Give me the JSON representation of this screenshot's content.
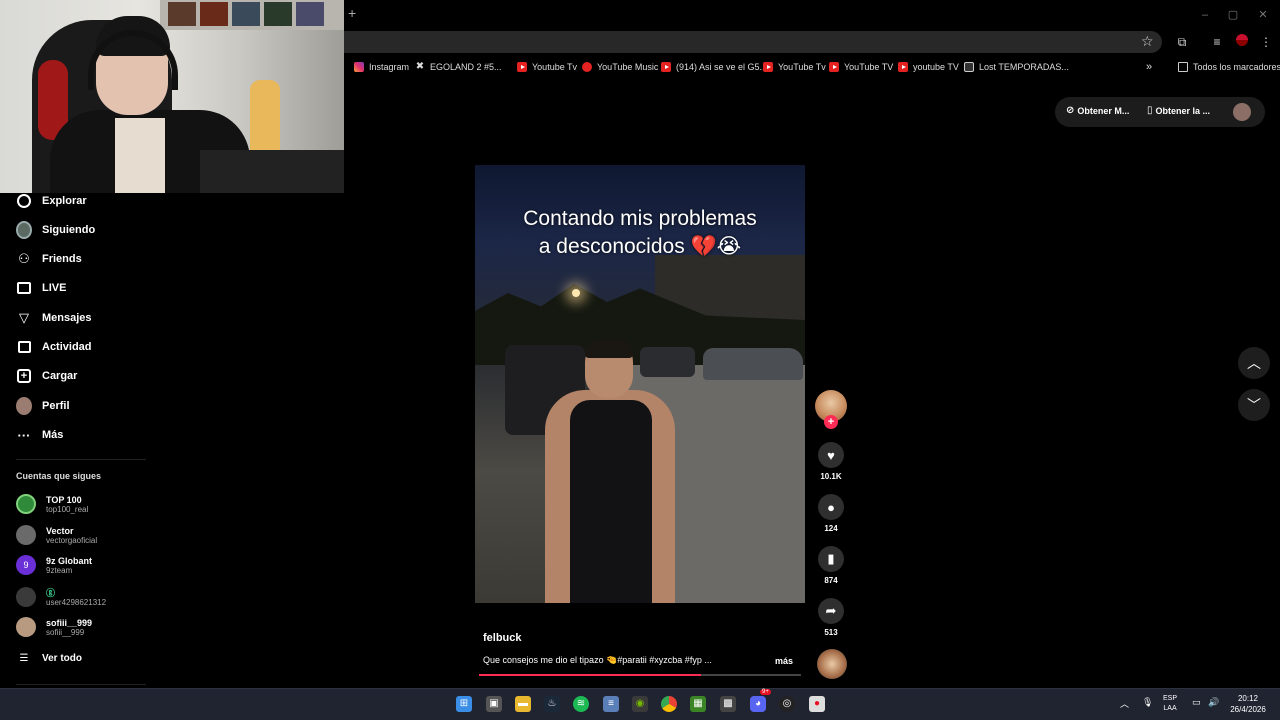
{
  "browser": {
    "bookmarks": [
      {
        "label": "Instagram",
        "icon": "instagram-icon"
      },
      {
        "label": "EGOLAND 2 #5...",
        "icon": "swords-icon"
      },
      {
        "label": "Youtube Tv",
        "icon": "youtube-icon"
      },
      {
        "label": "YouTube Music",
        "icon": "youtube-music-icon"
      },
      {
        "label": "(914) Asi se ve el G5...",
        "icon": "youtube-icon"
      },
      {
        "label": "YouTube Tv",
        "icon": "youtube-icon"
      },
      {
        "label": "YouTube TV",
        "icon": "youtube-icon"
      },
      {
        "label": "youtube TV",
        "icon": "youtube-icon"
      },
      {
        "label": "Lost TEMPORADAS...",
        "icon": "tv-icon"
      }
    ],
    "all_bookmarks": "Todos los marcadores"
  },
  "sidebar": {
    "nav": [
      {
        "label": "Explorar",
        "icon": "compass-icon"
      },
      {
        "label": "Siguiendo",
        "icon": "following-avatar-icon"
      },
      {
        "label": "Friends",
        "icon": "friends-icon"
      },
      {
        "label": "LIVE",
        "icon": "live-icon"
      },
      {
        "label": "Mensajes",
        "icon": "send-icon"
      },
      {
        "label": "Actividad",
        "icon": "activity-icon"
      },
      {
        "label": "Cargar",
        "icon": "upload-icon"
      },
      {
        "label": "Perfil",
        "icon": "profile-avatar-icon"
      },
      {
        "label": "Más",
        "icon": "more-dots-icon"
      }
    ],
    "following_title": "Cuentas que sigues",
    "following": [
      {
        "name": "TOP 100",
        "handle": "top100_real",
        "color": "#2f8a3a"
      },
      {
        "name": "Vector",
        "handle": "vectorgaoficial",
        "color": "#6a6a6a"
      },
      {
        "name": "9z Globant",
        "handle": "9zteam",
        "color": "#6a2fd6"
      },
      {
        "name": "",
        "handle": "user4298621312",
        "color": "#3a3a3a"
      },
      {
        "name": "sofiii__999",
        "handle": "sofiii__999",
        "color": "#b89a80"
      }
    ],
    "see_all": "Ver todo"
  },
  "header": {
    "get_coins": "Obtener M...",
    "get_app": "Obtener la ..."
  },
  "video": {
    "caption_line1": "Contando mis problemas",
    "caption_line2": "a desconocidos 💔😭",
    "author": "felbuck",
    "description": "Que consejos me dio el tipazo 🤏#paratii #xyzcba #fyp ...",
    "more": "más",
    "progress": 0.69,
    "likes": "10.1K",
    "comments": "124",
    "saves": "874",
    "shares": "513"
  },
  "taskbar": {
    "lang1": "ESP",
    "lang2": "LAA",
    "time": "20:12",
    "date": "26/4/2026",
    "discord_badge": "9+"
  },
  "colors": {
    "accent": "#fe2c55",
    "background": "#000000",
    "taskbar": "#1f2430"
  }
}
